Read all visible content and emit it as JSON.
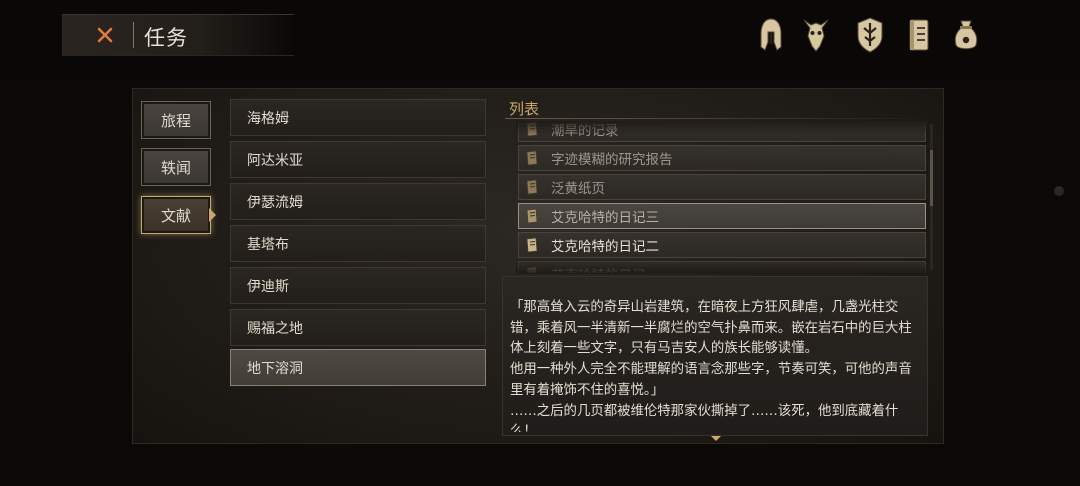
{
  "header": {
    "close_icon": "close-x-icon",
    "title": "任务",
    "hud_icons": [
      "helmet-icon",
      "beast-skull-icon",
      "crest-shield-icon",
      "journal-icon",
      "pouch-icon"
    ]
  },
  "categories": [
    {
      "label": "旅程",
      "active": false
    },
    {
      "label": "轶闻",
      "active": false
    },
    {
      "label": "文献",
      "active": true
    }
  ],
  "regions": [
    {
      "label": "海格姆"
    },
    {
      "label": "阿达米亚"
    },
    {
      "label": "伊瑟流姆"
    },
    {
      "label": "基塔布"
    },
    {
      "label": "伊迪斯"
    },
    {
      "label": "赐福之地"
    },
    {
      "label": "地下溶洞",
      "selected": true
    }
  ],
  "document_list": {
    "label": "列表",
    "items": [
      {
        "title": "潮旱的记录",
        "state": "read"
      },
      {
        "title": "字迹模糊的研究报告",
        "state": "read"
      },
      {
        "title": "泛黄纸页",
        "state": "read"
      },
      {
        "title": "艾克哈特的日记三",
        "state": "selected"
      },
      {
        "title": "艾克哈特的日记二",
        "state": "unread"
      },
      {
        "title": "艾克哈特的日记一",
        "state": "read"
      }
    ]
  },
  "document_text": "「那高耸入云的奇异山岩建筑，在暗夜上方狂风肆虐，几盏光柱交错，乘着风一半清新一半腐烂的空气扑鼻而来。嵌在岩石中的巨大柱体上刻着一些文字，只有马吉安人的族长能够读懂。\n他用一种外人完全不能理解的语言念那些字，节奏可笑，可他的声音里有着掩饰不住的喜悦。」\n……之后的几页都被维伦特那家伙撕掉了……该死，他到底藏着什么！"
}
